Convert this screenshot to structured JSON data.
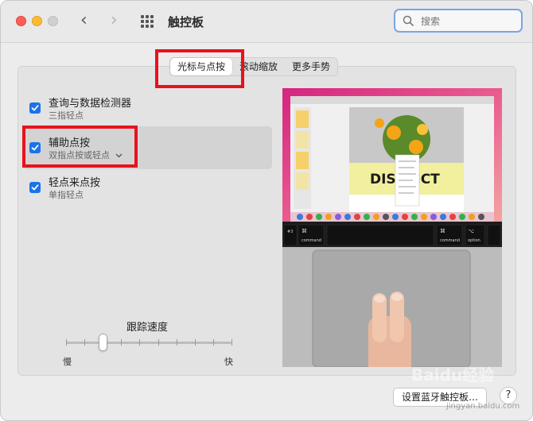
{
  "window": {
    "title": "触控板"
  },
  "search": {
    "placeholder": "搜索"
  },
  "tabs": [
    {
      "label": "光标与点按",
      "active": true
    },
    {
      "label": "滚动缩放",
      "active": false
    },
    {
      "label": "更多手势",
      "active": false
    }
  ],
  "options": [
    {
      "title": "查询与数据检测器",
      "subtitle": "三指轻点",
      "checked": true
    },
    {
      "title": "辅助点按",
      "subtitle": "双指点按或轻点",
      "checked": true,
      "has_dropdown": true
    },
    {
      "title": "轻点来点按",
      "subtitle": "单指轻点",
      "checked": true
    }
  ],
  "tracking": {
    "label": "跟踪速度",
    "min_label": "慢",
    "max_label": "快",
    "value_fraction": 0.22,
    "ticks": 10
  },
  "preview": {
    "doc_heading": "DISTRICT",
    "keys": {
      "left_top": "#3",
      "command": "command",
      "option": "option",
      "cmd_symbol": "⌘",
      "alt_symbol": "⌥"
    }
  },
  "footer": {
    "setup_button": "设置蓝牙触控板…",
    "help_button": "?"
  },
  "watermark": {
    "brand": "Baidu经验",
    "sub": "jingyan.baidu.com"
  },
  "colors": {
    "accent": "#1a73e8",
    "annotation": "#e8121b"
  }
}
